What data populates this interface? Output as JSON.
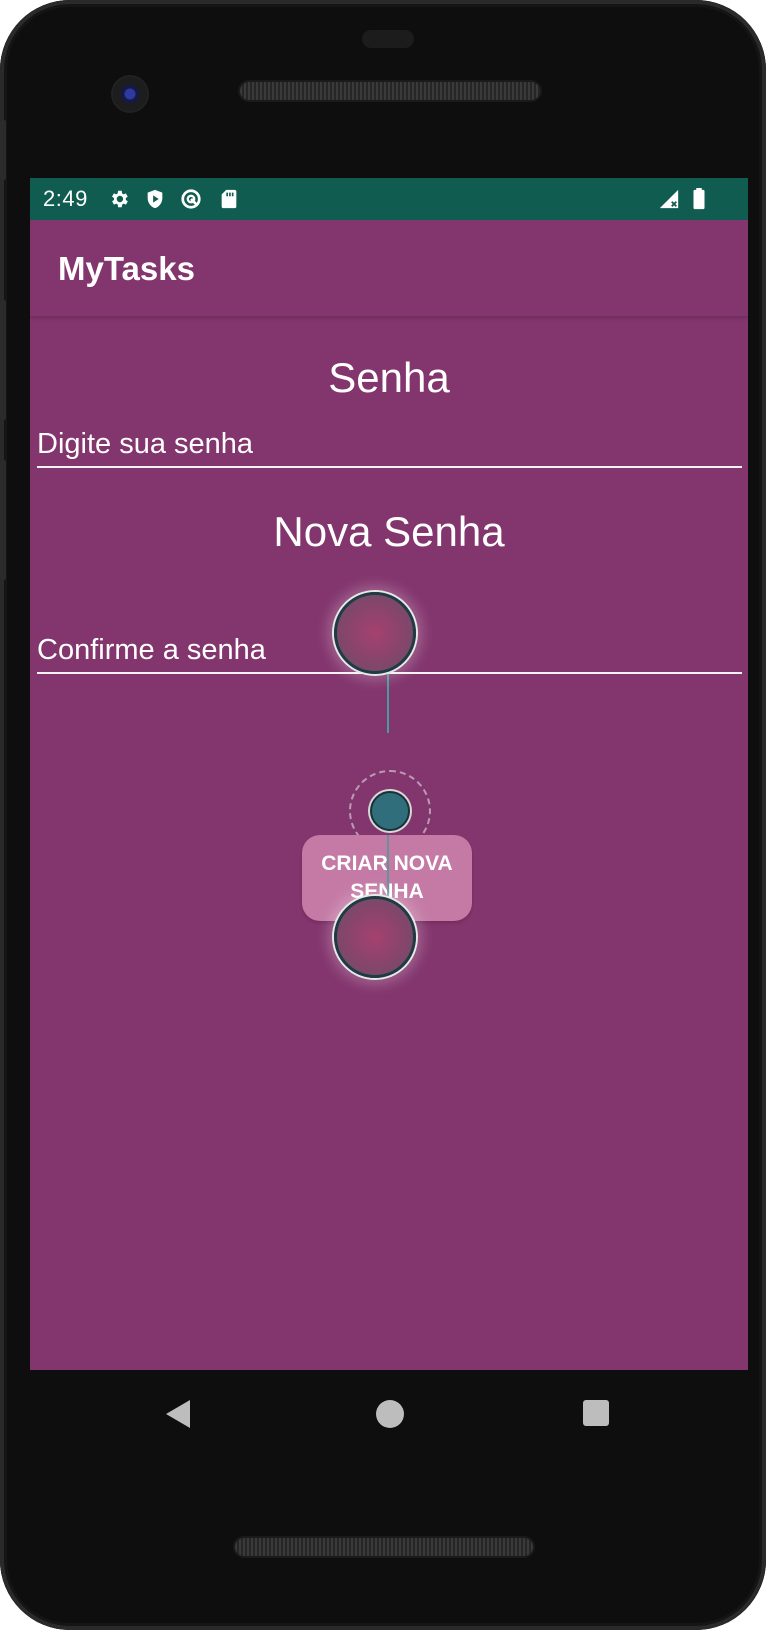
{
  "status_bar": {
    "time": "2:49",
    "icons": [
      "settings-icon",
      "shield-play-icon",
      "sync-icon",
      "sd-card-icon",
      "signal-icon",
      "battery-icon"
    ]
  },
  "app_bar": {
    "title": "MyTasks"
  },
  "form": {
    "heading_password": "Senha",
    "password_placeholder": "Digite sua senha",
    "heading_new_password": "Nova Senha",
    "confirm_placeholder": "Confirme a senha",
    "submit_label": "CRIAR NOVA SENHA"
  },
  "nav": {
    "icons": [
      "back-icon",
      "home-icon",
      "recents-icon"
    ]
  },
  "colors": {
    "status_bar": "#115c50",
    "app_background": "#83356d",
    "button": "#c47aa5"
  }
}
